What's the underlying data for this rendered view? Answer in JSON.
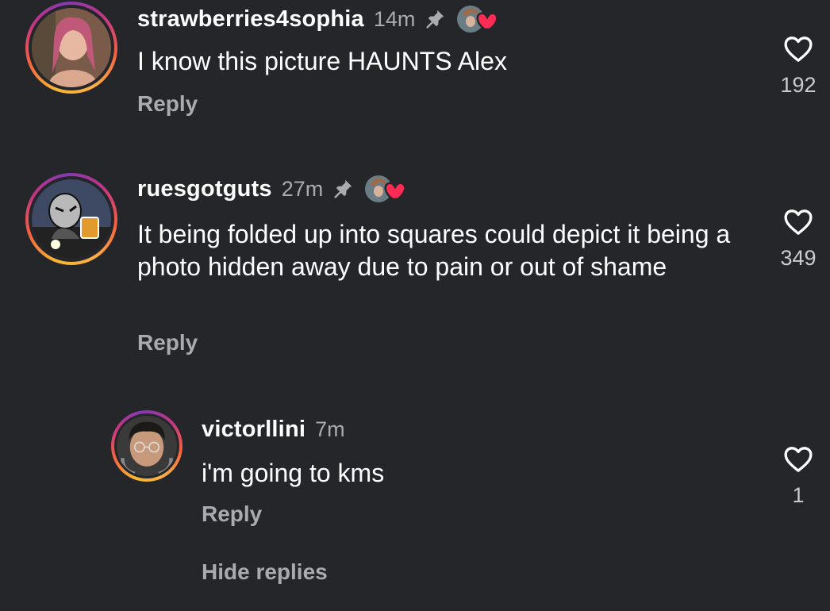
{
  "comments": [
    {
      "username": "strawberries4sophia",
      "time": "14m",
      "text": "I know this picture HAUNTS Alex",
      "reply_label": "Reply",
      "like_count": "192",
      "pinned": true,
      "liked_by_creator": true
    },
    {
      "username": "ruesgotguts",
      "time": "27m",
      "text": "It being folded up into squares could depict it being a photo hidden away due to pain or out of shame",
      "reply_label": "Reply",
      "like_count": "349",
      "pinned": true,
      "liked_by_creator": true
    }
  ],
  "reply": {
    "username": "victorllini",
    "time": "7m",
    "text": "i'm going to kms",
    "reply_label": "Reply",
    "like_count": "1"
  },
  "hide_replies_label": "Hide replies",
  "colors": {
    "background": "#25262a",
    "secondary_text": "#a9abb1",
    "heart_red": "#fe2c55",
    "ring_gradient": [
      "#f7b733",
      "#f56040",
      "#c13584",
      "#833ab4"
    ]
  },
  "icons": {
    "pin": "pin-icon",
    "like": "heart-outline-icon",
    "creator_like": "creator-liked-badge-icon"
  }
}
